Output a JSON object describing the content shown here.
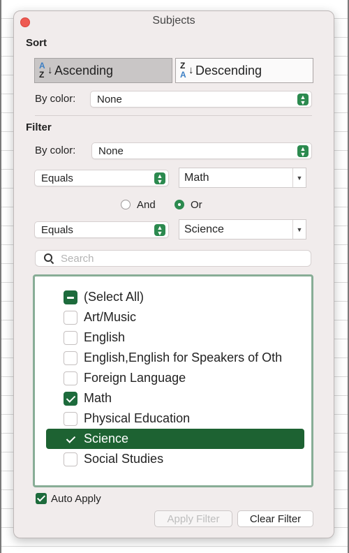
{
  "dialog": {
    "title": "Subjects"
  },
  "sort": {
    "heading": "Sort",
    "ascending_label": "Ascending",
    "descending_label": "Descending",
    "by_color_label": "By color:",
    "by_color_value": "None"
  },
  "filter": {
    "heading": "Filter",
    "by_color_label": "By color:",
    "by_color_value": "None",
    "condition1": {
      "operator": "Equals",
      "value": "Math"
    },
    "and_label": "And",
    "or_label": "Or",
    "selected_logic": "Or",
    "condition2": {
      "operator": "Equals",
      "value": "Science"
    },
    "search_placeholder": "Search",
    "items": [
      {
        "label": "(Select All)",
        "state": "mixed"
      },
      {
        "label": "Art/Music",
        "state": "unchecked"
      },
      {
        "label": "English",
        "state": "unchecked"
      },
      {
        "label": "English,English for Speakers of Oth",
        "state": "unchecked"
      },
      {
        "label": "Foreign Language",
        "state": "unchecked"
      },
      {
        "label": "Math",
        "state": "checked"
      },
      {
        "label": "Physical Education",
        "state": "unchecked"
      },
      {
        "label": "Science",
        "state": "checked",
        "highlighted": true
      },
      {
        "label": "Social Studies",
        "state": "unchecked"
      }
    ]
  },
  "footer": {
    "auto_apply_label": "Auto Apply",
    "auto_apply_checked": true,
    "apply_filter_label": "Apply Filter",
    "clear_filter_label": "Clear Filter"
  },
  "colors": {
    "accent": "#1d6b3c",
    "highlight": "#1d6232",
    "list_border": "#88ad96"
  }
}
